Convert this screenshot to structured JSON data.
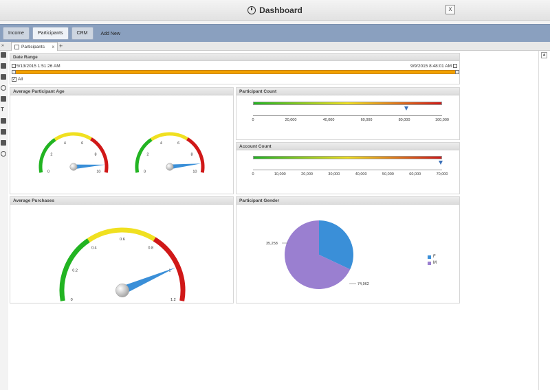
{
  "window": {
    "title": "Dashboard",
    "close_label": "x"
  },
  "nav": {
    "tabs": [
      {
        "label": "Income"
      },
      {
        "label": "Participants"
      },
      {
        "label": "CRM"
      },
      {
        "label": "Add New"
      }
    ]
  },
  "doc_tab": {
    "label": "Participants",
    "close": "x",
    "add": "+",
    "collapse": "»"
  },
  "date_range": {
    "title": "Date Range",
    "from": "5/13/2015 1:51:26 AM",
    "to": "9/9/2015 8:48:01 AM",
    "all_label": "All",
    "all_checked": true
  },
  "avg_age": {
    "title": "Average Participant Age",
    "gauges": [
      {
        "ticks": [
          "0",
          "2",
          "4",
          "6",
          "8",
          "10"
        ],
        "min": 0,
        "max": 10,
        "value": 9.3
      },
      {
        "ticks": [
          "0",
          "2",
          "4",
          "6",
          "8",
          "10"
        ],
        "min": 0,
        "max": 10,
        "value": 9.2
      }
    ]
  },
  "participant_count": {
    "title": "Participant Count",
    "ticks": [
      "0",
      "20,000",
      "40,000",
      "60,000",
      "80,000",
      "100,000"
    ],
    "min": 0,
    "max": 100000,
    "value": 81000
  },
  "account_count": {
    "title": "Account Count",
    "ticks": [
      "0",
      "10,000",
      "20,000",
      "30,000",
      "40,000",
      "50,000",
      "60,000",
      "70,000"
    ],
    "min": 0,
    "max": 70000,
    "value": 69500
  },
  "avg_purchases": {
    "title": "Average Purchases",
    "ticks": [
      "0",
      "0.2",
      "0.4",
      "0.6",
      "0.8",
      "1",
      "1.2"
    ],
    "min": 0,
    "max": 1.2,
    "value": 1.0
  },
  "gender": {
    "title": "Participant Gender",
    "slices": [
      {
        "label": "F",
        "value": 35258,
        "value_label": "35,258",
        "color": "#3a8fd8"
      },
      {
        "label": "M",
        "value": 74962,
        "value_label": "74,962",
        "color": "#9a7fd0"
      }
    ]
  },
  "colors": {
    "nav": "#8aa0bf",
    "slider": "#f2a100",
    "green": "#22b422",
    "yellow": "#f0e020",
    "red": "#d01818",
    "needle": "#3a8fd8"
  },
  "icons": [
    "clock-icon",
    "close-icon",
    "document-icon",
    "folder-icon",
    "save-icon",
    "refresh-icon",
    "table-icon",
    "text-icon",
    "chart-icon",
    "report-icon",
    "link-icon",
    "settings-icon",
    "calendar-icon"
  ]
}
